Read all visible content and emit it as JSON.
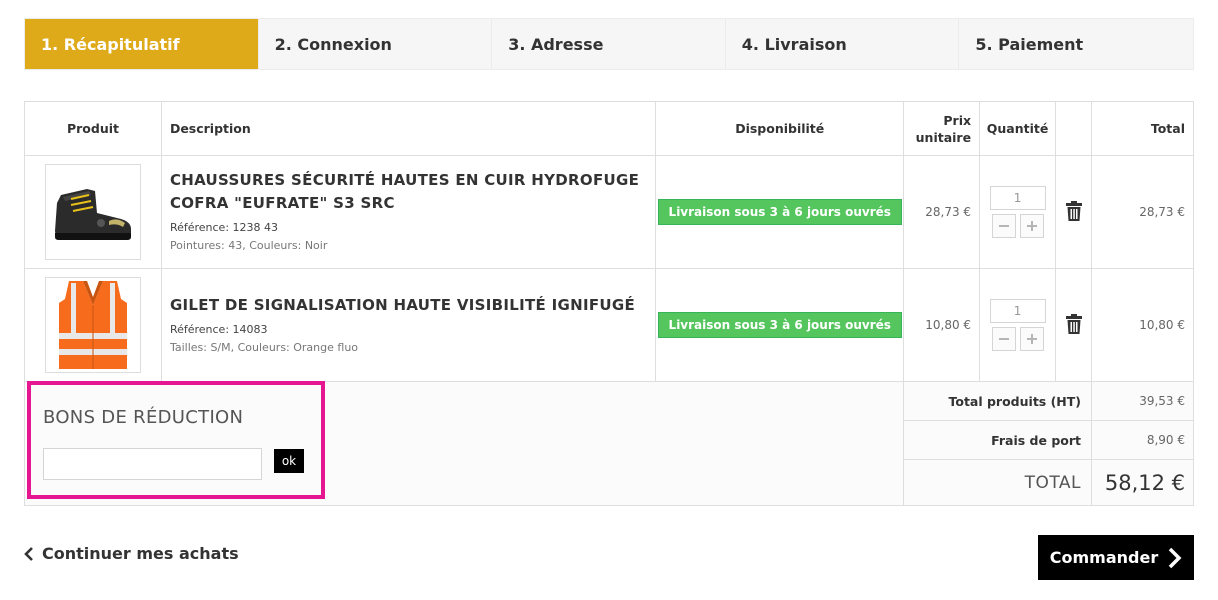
{
  "steps": [
    {
      "label": "1. Récapitulatif",
      "active": true
    },
    {
      "label": "2. Connexion",
      "active": false
    },
    {
      "label": "3. Adresse",
      "active": false
    },
    {
      "label": "4. Livraison",
      "active": false
    },
    {
      "label": "5. Paiement",
      "active": false
    }
  ],
  "table": {
    "headers": {
      "product": "Produit",
      "description": "Description",
      "availability": "Disponibilité",
      "unit_price": "Prix unitaire",
      "quantity": "Quantité",
      "total": "Total"
    }
  },
  "items": [
    {
      "name_line1": "CHAUSSURES SÉCURITÉ HAUTES EN CUIR HYDROFUGE",
      "name_line2": "COFRA \"EUFRATE\" S3 SRC",
      "reference": "Référence: 1238 43",
      "attributes": "Pointures: 43, Couleurs: Noir",
      "availability": "Livraison sous 3 à 6 jours ouvrés",
      "unit_price": "28,73 €",
      "quantity": "1",
      "total": "28,73 €",
      "image_icon": "safety-boot-icon"
    },
    {
      "name_line1": "GILET DE SIGNALISATION HAUTE VISIBILITÉ IGNIFUGÉ",
      "name_line2": "",
      "reference": "Référence: 14083",
      "attributes": "Tailles: S/M, Couleurs: Orange fluo",
      "availability": "Livraison sous 3 à 6 jours ouvrés",
      "unit_price": "10,80 €",
      "quantity": "1",
      "total": "10,80 €",
      "image_icon": "safety-vest-icon"
    }
  ],
  "summary": {
    "total_products_label": "Total produits (HT)",
    "total_products_value": "39,53 €",
    "shipping_label": "Frais de port",
    "shipping_value": "8,90 €",
    "total_label": "TOTAL",
    "total_value": "58,12 €"
  },
  "voucher": {
    "title": "BONS DE RÉDUCTION",
    "input_value": "",
    "ok_label": "ok"
  },
  "footer": {
    "continue_label": "Continuer mes achats",
    "order_label": "Commander"
  },
  "colors": {
    "active_step": "#dfaa1a",
    "availability_badge": "#55c65e",
    "voucher_highlight": "#e5168f",
    "order_button": "#000000"
  }
}
